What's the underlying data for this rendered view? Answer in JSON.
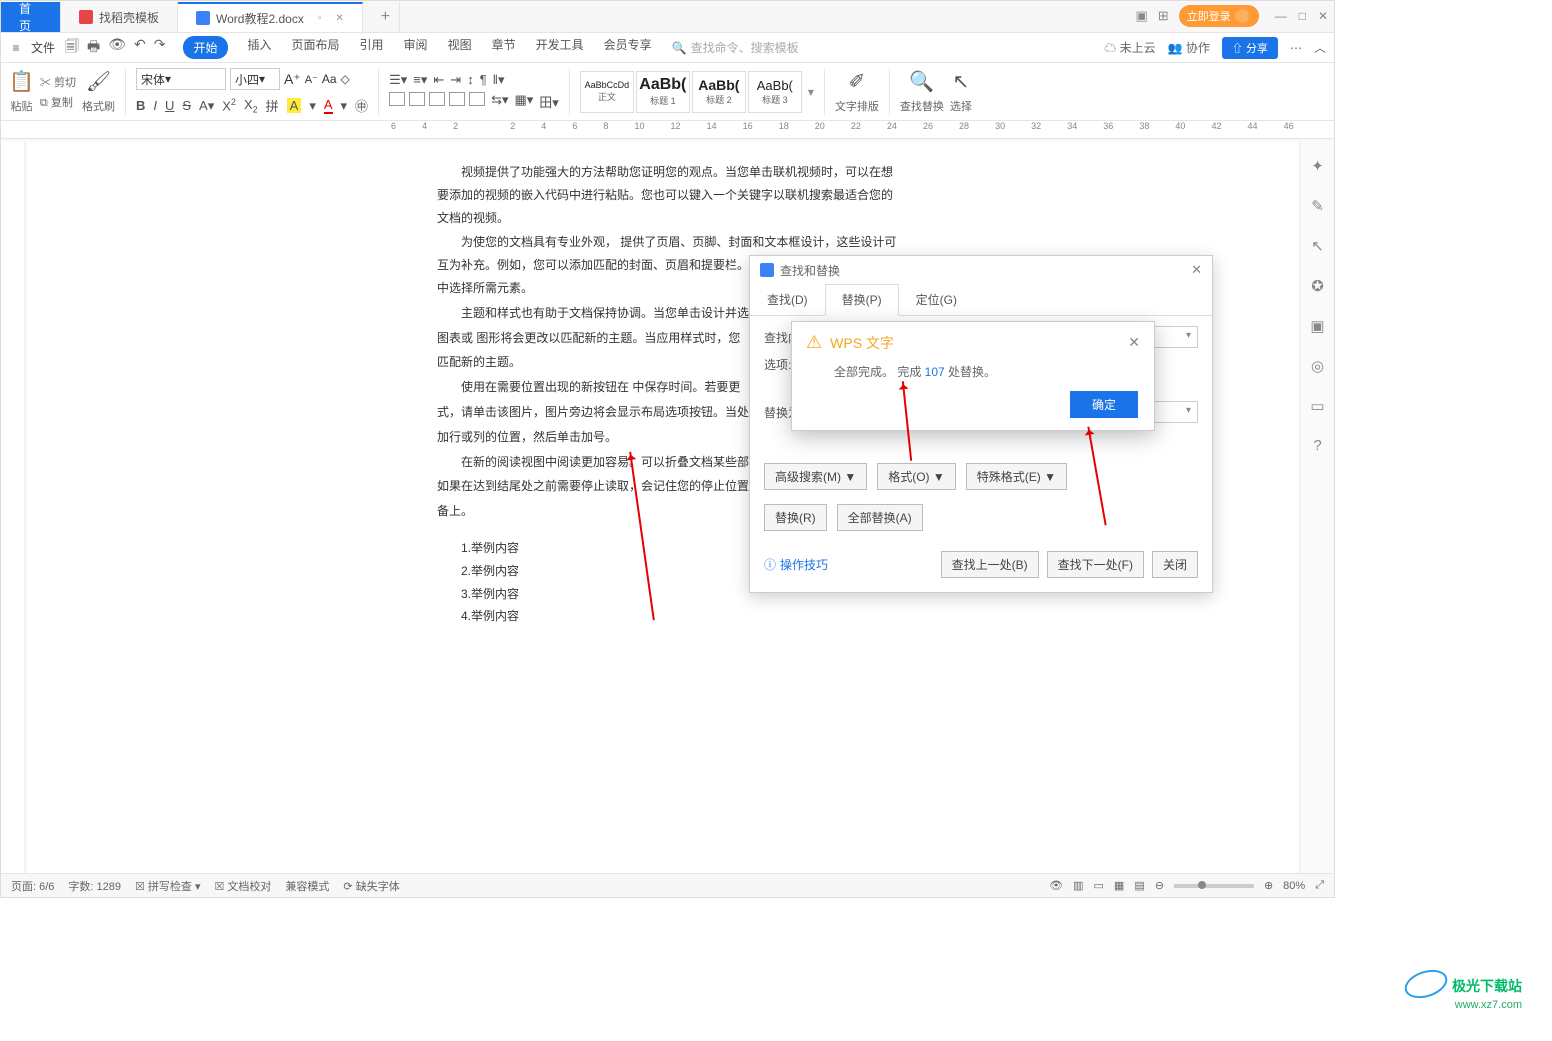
{
  "tabs": {
    "home": "首页",
    "t1_icon": "flame-icon",
    "t1": "找稻壳模板",
    "t2_icon": "word-icon",
    "t2": "Word教程2.docx"
  },
  "title_right": {
    "login": "立即登录"
  },
  "menubar": {
    "file": "文件",
    "items": [
      "开始",
      "插入",
      "页面布局",
      "引用",
      "审阅",
      "视图",
      "章节",
      "开发工具",
      "会员专享"
    ],
    "search_ph": "查找命令、搜索模板",
    "cloud": "未上云",
    "collab": "协作",
    "share": "分享"
  },
  "ribbon": {
    "paste": "粘贴",
    "cut": "剪切",
    "copy": "复制",
    "formatbrush": "格式刷",
    "font_name": "宋体",
    "font_size": "小四",
    "styles": [
      {
        "preview": "AaBbCcDd",
        "name": "正文"
      },
      {
        "preview": "AaBb(",
        "name": "标题 1"
      },
      {
        "preview": "AaBb(",
        "name": "标题 2"
      },
      {
        "preview": "AaBb(",
        "name": "标题 3"
      }
    ],
    "textlayout": "文字排版",
    "findreplace": "查找替换",
    "select": "选择"
  },
  "ruler_marks": [
    "6",
    "4",
    "2",
    "",
    "2",
    "4",
    "6",
    "8",
    "10",
    "12",
    "14",
    "16",
    "18",
    "20",
    "22",
    "24",
    "26",
    "28",
    "30",
    "32",
    "34",
    "36",
    "38",
    "40",
    "42",
    "44",
    "46"
  ],
  "document": {
    "p1": "视频提供了功能强大的方法帮助您证明您的观点。当您单击联机视频时，可以在想要添加的视频的嵌入代码中进行粘贴。您也可以键入一个关键字以联机搜索最适合您的文档的视频。",
    "p2": "为使您的文档具有专业外观， 提供了页眉、页脚、封面和文本框设计，这些设计可互为补充。例如，您可以添加匹配的封面、页眉和提要栏。单击\"插入\"，然后从不同库中选择所需元素。",
    "p3": "主题和样式也有助于文档保持协调。当您单击设计并选择",
    "p4": "图表或 图形将会更改以匹配新的主题。当应用样式时，您",
    "p5": "匹配新的主题。",
    "p6": "使用在需要位置出现的新按钮在 中保存时间。若要更",
    "p7": "式，请单击该图片，图片旁边将会显示布局选项按钮。当处",
    "p8": "加行或列的位置，然后单击加号。",
    "p9": "在新的阅读视图中阅读更加容易。可以折叠文档某些部",
    "p10": "如果在达到结尾处之前需要停止读取，会记住您的停止位置",
    "p11": "备上。",
    "list": [
      "1.举例内容",
      "2.举例内容",
      "3.举例内容",
      "4.举例内容"
    ]
  },
  "dialog": {
    "title": "查找和替换",
    "tabs": {
      "find": "查找(D)",
      "replace": "替换(P)",
      "goto": "定位(G)"
    },
    "find_label": "查找内",
    "opts_label": "选项:",
    "replace_label": "替换为",
    "adv": "高级搜索(M)",
    "format": "格式(O)",
    "special": "特殊格式(E)",
    "btn_replace": "替换(R)",
    "btn_replace_all": "全部替换(A)",
    "tips": "操作技巧",
    "find_prev": "查找上一处(B)",
    "find_next": "查找下一处(F)",
    "close": "关闭"
  },
  "alert": {
    "title": "WPS 文字",
    "msg_pre": "全部完成。 完成 ",
    "num": "107",
    "msg_post": " 处替换。",
    "ok": "确定"
  },
  "statusbar": {
    "page": "页面: 6/6",
    "words": "字数: 1289",
    "spell": "拼写检查",
    "proof": "文档校对",
    "compat": "兼容模式",
    "missfont": "缺失字体",
    "zoom": "80%"
  },
  "watermark": {
    "name": "极光下载站",
    "domain": "www.xz7.com"
  }
}
